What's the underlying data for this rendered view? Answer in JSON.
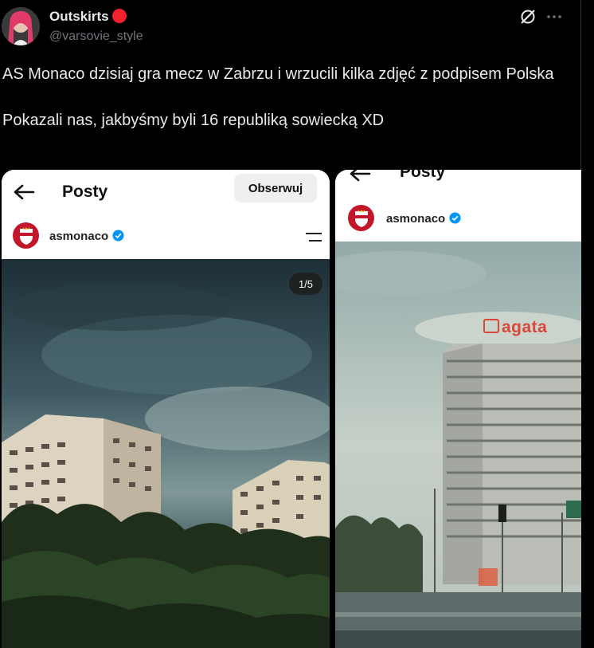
{
  "post": {
    "author_name": "Outskirts",
    "author_handle": "@varsovie_style",
    "text": "AS Monaco dzisiaj gra mecz w Zabrzu i wrzucili kilka zdjęć z podpisem Polska\n\nPokazali nas, jakbyśmy byli 16 republiką sowiecką XD"
  },
  "header_icons": [
    "grok-icon",
    "more-icon"
  ],
  "embedded_screenshots": [
    {
      "title": "Posty",
      "follow_label": "Obserwuj",
      "account": "asmonaco",
      "counter": "1/5"
    },
    {
      "title": "Posty",
      "account": "asmonaco",
      "building_sign": "agata"
    }
  ],
  "colors": {
    "background": "#000000",
    "text": "#e7e9ea",
    "muted": "#71767b",
    "badge": "#f4212e",
    "verified": "#0095f6",
    "monaco_red": "#c4162a"
  }
}
